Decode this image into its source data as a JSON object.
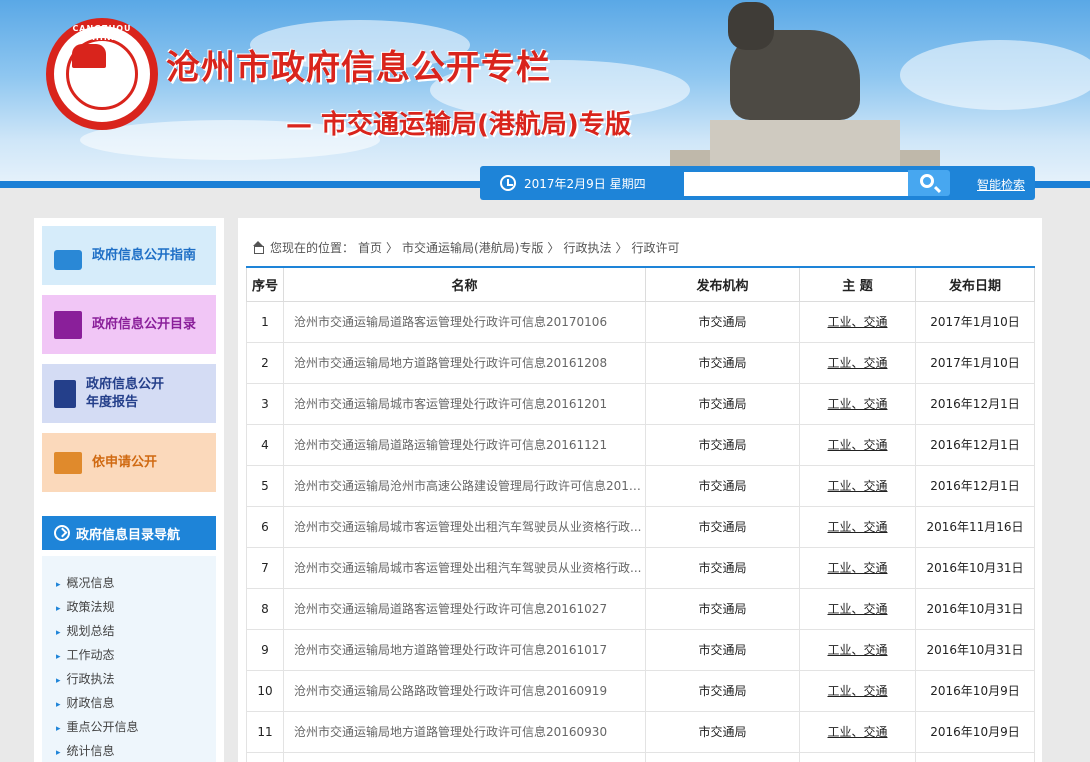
{
  "header": {
    "title": "沧州市政府信息公开专栏",
    "subtitle": "— 市交通运输局(港航局)专版",
    "logo_text": "CANGZHOU CHINA",
    "date": "2017年2月9日 星期四",
    "search_placeholder": "",
    "advanced_search": "智能检索"
  },
  "sidebar": {
    "buttons": [
      {
        "label": "政府信息公开指南"
      },
      {
        "label": "政府信息公开目录"
      },
      {
        "label": "政府信息公开年度报告"
      },
      {
        "label": "依申请公开"
      }
    ],
    "nav_title": "政府信息目录导航",
    "nav_items": [
      "概况信息",
      "政策法规",
      "规划总结",
      "工作动态",
      "行政执法",
      "财政信息",
      "重点公开信息",
      "统计信息"
    ]
  },
  "breadcrumb": {
    "prefix": "您现在的位置：",
    "items": [
      "首页",
      "〉",
      "市交通运输局(港航局)专版",
      "〉",
      "行政执法",
      "〉",
      "行政许可"
    ]
  },
  "table": {
    "headers": [
      "序号",
      "名称",
      "发布机构",
      "主 题",
      "发布日期"
    ],
    "rows": [
      {
        "no": "1",
        "name": "沧州市交通运输局道路客运管理处行政许可信息20170106",
        "org": "市交通局",
        "topic": "工业、交通",
        "date": "2017年1月10日"
      },
      {
        "no": "2",
        "name": "沧州市交通运输局地方道路管理处行政许可信息20161208",
        "org": "市交通局",
        "topic": "工业、交通",
        "date": "2017年1月10日"
      },
      {
        "no": "3",
        "name": "沧州市交通运输局城市客运管理处行政许可信息20161201",
        "org": "市交通局",
        "topic": "工业、交通",
        "date": "2016年12月1日"
      },
      {
        "no": "4",
        "name": "沧州市交通运输局道路运输管理处行政许可信息20161121",
        "org": "市交通局",
        "topic": "工业、交通",
        "date": "2016年12月1日"
      },
      {
        "no": "5",
        "name": "沧州市交通运输局沧州市高速公路建设管理局行政许可信息2016...",
        "org": "市交通局",
        "topic": "工业、交通",
        "date": "2016年12月1日"
      },
      {
        "no": "6",
        "name": "沧州市交通运输局城市客运管理处出租汽车驾驶员从业资格行政...",
        "org": "市交通局",
        "topic": "工业、交通",
        "date": "2016年11月16日"
      },
      {
        "no": "7",
        "name": "沧州市交通运输局城市客运管理处出租汽车驾驶员从业资格行政...",
        "org": "市交通局",
        "topic": "工业、交通",
        "date": "2016年10月31日"
      },
      {
        "no": "8",
        "name": "沧州市交通运输局道路客运管理处行政许可信息20161027",
        "org": "市交通局",
        "topic": "工业、交通",
        "date": "2016年10月31日"
      },
      {
        "no": "9",
        "name": "沧州市交通运输局地方道路管理处行政许可信息20161017",
        "org": "市交通局",
        "topic": "工业、交通",
        "date": "2016年10月31日"
      },
      {
        "no": "10",
        "name": "沧州市交通运输局公路路政管理处行政许可信息20160919",
        "org": "市交通局",
        "topic": "工业、交通",
        "date": "2016年10月9日"
      },
      {
        "no": "11",
        "name": "沧州市交通运输局地方道路管理处行政许可信息20160930",
        "org": "市交通局",
        "topic": "工业、交通",
        "date": "2016年10月9日"
      },
      {
        "no": "",
        "name": "",
        "org": "",
        "topic": "",
        "date": ""
      }
    ]
  },
  "colors": {
    "accent": "#1e84d8",
    "title_red": "#d9241c"
  }
}
